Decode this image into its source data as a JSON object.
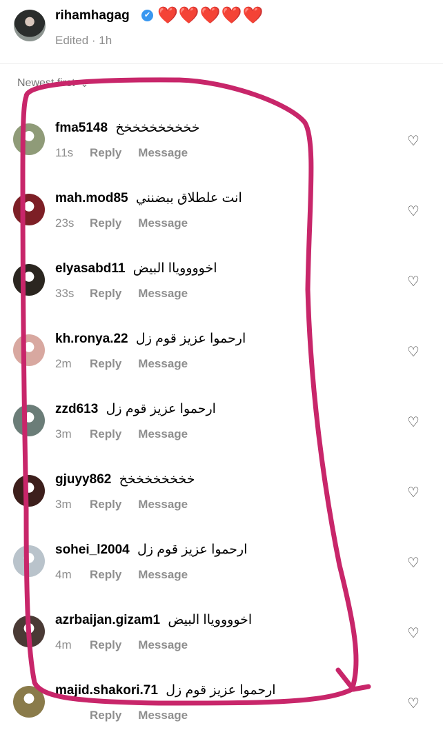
{
  "post": {
    "username": "rihamhagag",
    "verified_icon": "✔",
    "hearts": "❤️❤️❤️❤️❤️",
    "meta": "Edited · 1h"
  },
  "sort": {
    "label": "Newest first",
    "chevron": "⌄"
  },
  "actions": {
    "reply": "Reply",
    "message": "Message",
    "like_icon": "♡"
  },
  "comments": [
    {
      "username": "fma5148",
      "text": "خخخخخخخخخخ",
      "time": "11s",
      "avatar_color": "#8f9b78"
    },
    {
      "username": "mah.mod85",
      "text": "انت علطلاق ببضنني",
      "time": "23s",
      "avatar_color": "#7d1f26"
    },
    {
      "username": "elyasabd11",
      "text": "اخووووياا البيض",
      "time": "33s",
      "avatar_color": "#2b2620"
    },
    {
      "username": "kh.ronya.22",
      "text": "ارحموا عزيز قوم زل",
      "time": "2m",
      "avatar_color": "#d8a8a0"
    },
    {
      "username": "zzd613",
      "text": "ارحموا عزيز قوم زل",
      "time": "3m",
      "avatar_color": "#6b7d78"
    },
    {
      "username": "gjuyy862",
      "text": "خخخخخخخخخ",
      "time": "3m",
      "avatar_color": "#3d1f1c"
    },
    {
      "username": "sohei_l2004",
      "text": "ارحموا عزيز قوم زل",
      "time": "4m",
      "avatar_color": "#b9c3cb"
    },
    {
      "username": "azrbaijan.gizam1",
      "text": "اخووووياا البيض",
      "time": "4m",
      "avatar_color": "#4a3a35"
    },
    {
      "username": "majid.shakori.71",
      "text": "ارحموا عزيز قوم زل",
      "time": "",
      "avatar_color": "#8a7b4a"
    }
  ],
  "colors": {
    "annotation": "#c8266a",
    "muted": "#8e8e8e"
  }
}
